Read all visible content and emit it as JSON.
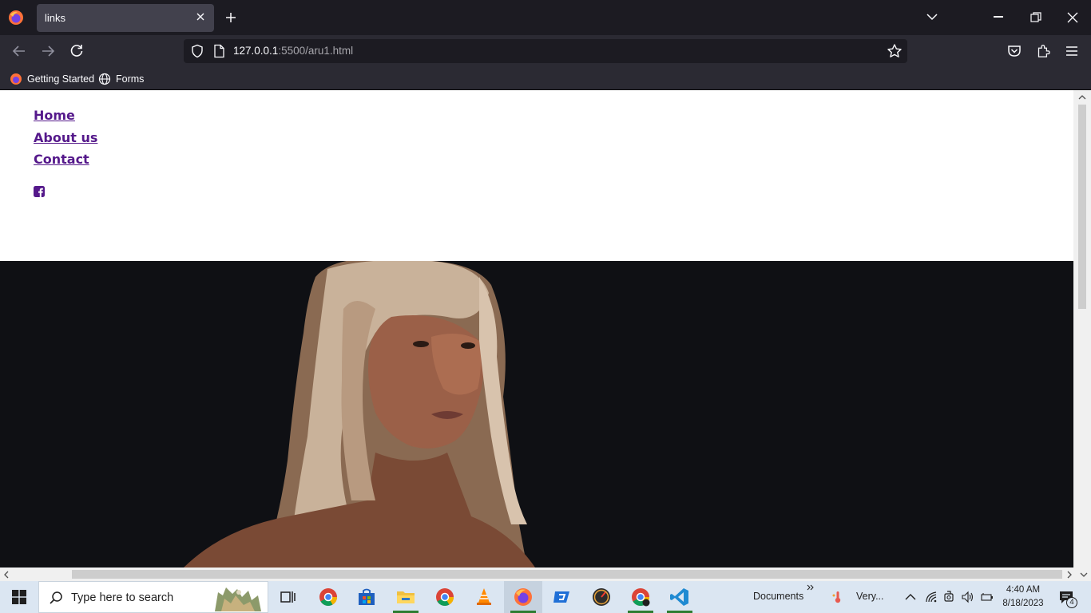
{
  "browser": {
    "tab_title": "links",
    "url_host": "127.0.0.1",
    "url_rest": ":5500/aru1.html",
    "bookmarks": [
      {
        "label": "Getting Started"
      },
      {
        "label": "Forms"
      }
    ]
  },
  "page": {
    "nav_links": [
      "Home",
      "About us",
      "Contact"
    ],
    "social_icon": "facebook-square-icon",
    "link_color": "#55198b"
  },
  "taskbar": {
    "search_placeholder": "Type here to search",
    "documents_label": "Documents",
    "weather_label": "Very...",
    "time": "4:40 AM",
    "date": "8/18/2023",
    "notification_count": "4"
  }
}
